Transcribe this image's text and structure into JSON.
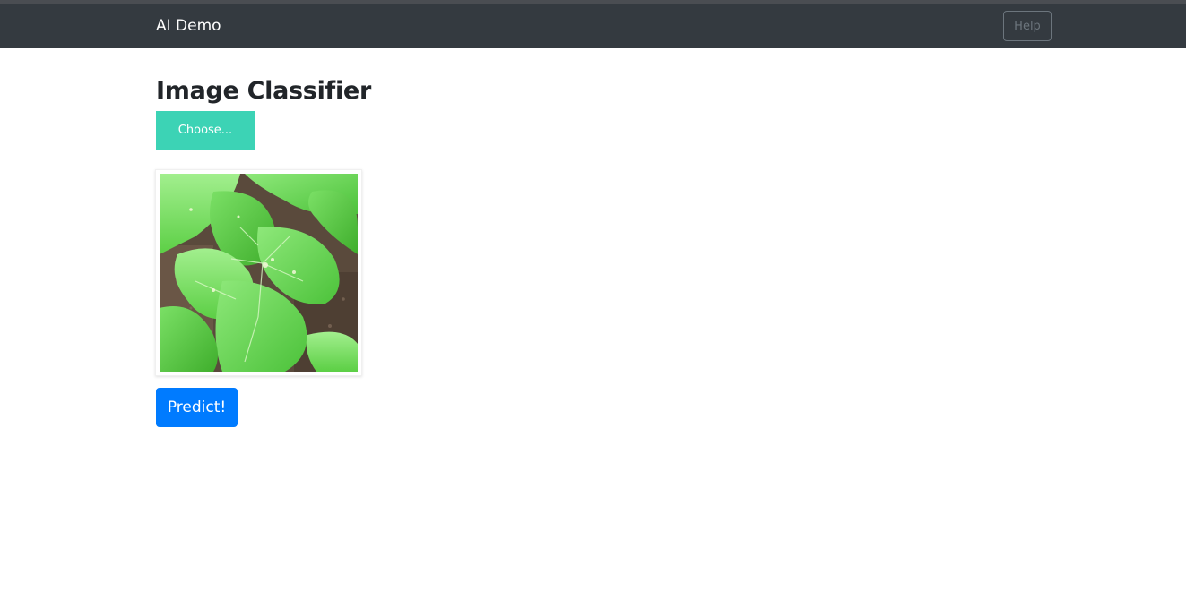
{
  "navbar": {
    "brand": "AI Demo",
    "help_label": "Help"
  },
  "main": {
    "title": "Image Classifier",
    "choose_label": "Choose...",
    "predict_label": "Predict!",
    "preview_image": "plant-leaves-photo"
  },
  "colors": {
    "navbar_bg": "#343a40",
    "choose_button": "#3cd3b5",
    "predict_button": "#007bff"
  }
}
